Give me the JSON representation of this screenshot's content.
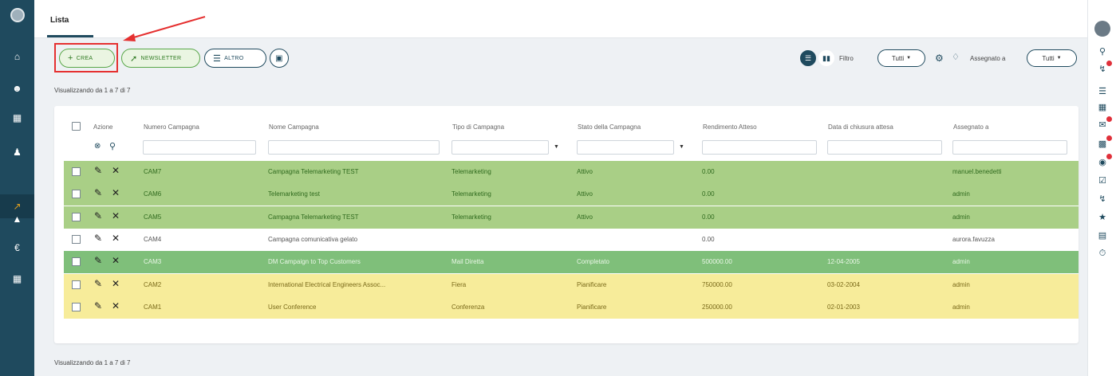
{
  "tabs": {
    "lista": "Lista"
  },
  "toolbar": {
    "crea_icon": "+",
    "crea": "CREA",
    "newsletter": "NEWSLETTER",
    "altro": "ALTRO",
    "filtro_label": "Filtro",
    "filtro_value": "Tutti",
    "assegnato_label": "Assegnato a",
    "assegnato_value": "Tutti"
  },
  "showing_top": "Visualizzando da 1 a 7 di 7",
  "showing_bottom": "Visualizzando da 1 a 7 di 7",
  "table": {
    "headers": {
      "azione": "Azione",
      "numero": "Numero Campagna",
      "nome": "Nome Campagna",
      "tipo": "Tipo di Campagna",
      "stato": "Stato della Campagna",
      "rendimento": "Rendimento Atteso",
      "data": "Data di chiusura attesa",
      "assegnato": "Assegnato a"
    },
    "rows": [
      {
        "numero": "CAM7",
        "nome": "Campagna Telemarketing TEST",
        "tipo": "Telemarketing",
        "stato": "Attivo",
        "rendimento": "0.00",
        "data": "",
        "assegnato": "manuel.benedetti",
        "bg": "#a9cf86",
        "fg": "#2f6a1e"
      },
      {
        "numero": "CAM6",
        "nome": "Telemarketing test",
        "tipo": "Telemarketing",
        "stato": "Attivo",
        "rendimento": "0.00",
        "data": "",
        "assegnato": "admin",
        "bg": "#a9cf86",
        "fg": "#2f6a1e"
      },
      {
        "numero": "CAM5",
        "nome": "Campagna Telemarketing TEST",
        "tipo": "Telemarketing",
        "stato": "Attivo",
        "rendimento": "0.00",
        "data": "",
        "assegnato": "admin",
        "bg": "#a9cf86",
        "fg": "#2f6a1e"
      },
      {
        "numero": "CAM4",
        "nome": "Campagna comunicativa gelato",
        "tipo": "",
        "stato": "",
        "rendimento": "0.00",
        "data": "",
        "assegnato": "aurora.favuzza",
        "bg": "#ffffff",
        "fg": "#555555"
      },
      {
        "numero": "CAM3",
        "nome": "DM Campaign to Top Customers",
        "tipo": "Mail Diretta",
        "stato": "Completato",
        "rendimento": "500000.00",
        "data": "12-04-2005",
        "assegnato": "admin",
        "bg": "#7fbf7a",
        "fg": "#e9f6e6"
      },
      {
        "numero": "CAM2",
        "nome": "International Electrical Engineers Assoc...",
        "tipo": "Fiera",
        "stato": "Pianificare",
        "rendimento": "750000.00",
        "data": "03-02-2004",
        "assegnato": "admin",
        "bg": "#f7ec9a",
        "fg": "#7a6a1a"
      },
      {
        "numero": "CAM1",
        "nome": "User Conference",
        "tipo": "Conferenza",
        "stato": "Pianificare",
        "rendimento": "250000.00",
        "data": "02-01-2003",
        "assegnato": "admin",
        "bg": "#f7ec9a",
        "fg": "#7a6a1a"
      }
    ]
  },
  "colors": {
    "sidebar": "#1f4a5e",
    "accent_red": "#e53030",
    "crea_green": "#5aa84a"
  }
}
